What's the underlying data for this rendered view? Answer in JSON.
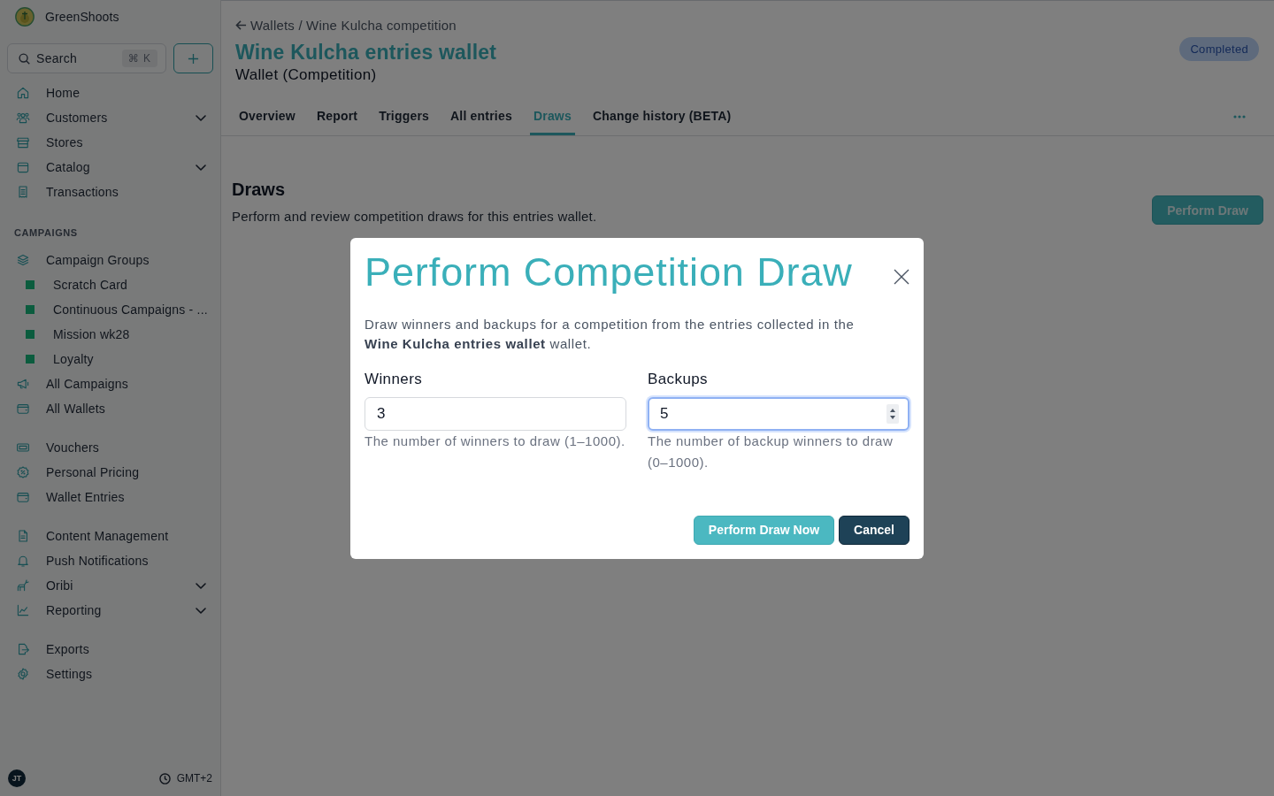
{
  "sidebar": {
    "brand": "GreenShoots",
    "search": {
      "placeholder": "Search",
      "shortcut": "⌘ K"
    },
    "sections": [
      {
        "items": [
          {
            "label": "Home",
            "kind": "link"
          },
          {
            "label": "Customers",
            "kind": "submenu"
          },
          {
            "label": "Stores",
            "kind": "link"
          },
          {
            "label": "Catalog",
            "kind": "submenu"
          },
          {
            "label": "Transactions",
            "kind": "link"
          }
        ]
      },
      {
        "heading": "CAMPAIGNS",
        "items": [
          {
            "label": "Campaign Groups",
            "kind": "link",
            "children": [
              {
                "label": "Scratch Card"
              },
              {
                "label": "Continuous Campaigns - ..."
              },
              {
                "label": "Mission wk28"
              },
              {
                "label": "Loyalty"
              }
            ]
          },
          {
            "label": "All Campaigns",
            "kind": "link"
          },
          {
            "label": "All Wallets",
            "kind": "link"
          }
        ]
      },
      {
        "items": [
          {
            "label": "Vouchers",
            "kind": "link"
          },
          {
            "label": "Personal Pricing",
            "kind": "link"
          },
          {
            "label": "Wallet Entries",
            "kind": "link"
          }
        ]
      },
      {
        "items": [
          {
            "label": "Content Management",
            "kind": "link"
          },
          {
            "label": "Push Notifications",
            "kind": "link"
          },
          {
            "label": "Oribi",
            "kind": "submenu"
          },
          {
            "label": "Reporting",
            "kind": "submenu"
          }
        ]
      },
      {
        "items": [
          {
            "label": "Exports",
            "kind": "link"
          },
          {
            "label": "Settings",
            "kind": "link"
          }
        ]
      }
    ],
    "footer": {
      "avatar": "JT",
      "timezone": "GMT+2"
    }
  },
  "page": {
    "breadcrumb": "Wallets / Wine Kulcha competition",
    "title": "Wine Kulcha entries wallet",
    "subtitle": "Wallet (Competition)",
    "status": "Completed",
    "tabs": [
      {
        "label": "Overview",
        "selected": false
      },
      {
        "label": "Report",
        "selected": false
      },
      {
        "label": "Triggers",
        "selected": false
      },
      {
        "label": "All entries",
        "selected": false
      },
      {
        "label": "Draws",
        "selected": true
      },
      {
        "label": "Change history (BETA)",
        "selected": false
      }
    ],
    "section": {
      "heading": "Draws",
      "description": "Perform and review competition draws for this entries wallet.",
      "action": "Perform Draw"
    }
  },
  "modal": {
    "title": "Perform Competition Draw",
    "description": "Draw winners and backups for a competition from the entries collected in the **Wine Kulcha entries wallet** wallet.",
    "fields": [
      {
        "label": "Winners",
        "value": "3",
        "help": "The number of winners to draw (1–1000).",
        "focused": false
      },
      {
        "label": "Backups",
        "value": "5",
        "help": "The number of backup winners to draw (0–1000).",
        "focused": true
      }
    ],
    "buttons": [
      {
        "label": "Perform Draw Now",
        "kind": "primary"
      },
      {
        "label": "Cancel",
        "kind": "secondary"
      }
    ]
  }
}
